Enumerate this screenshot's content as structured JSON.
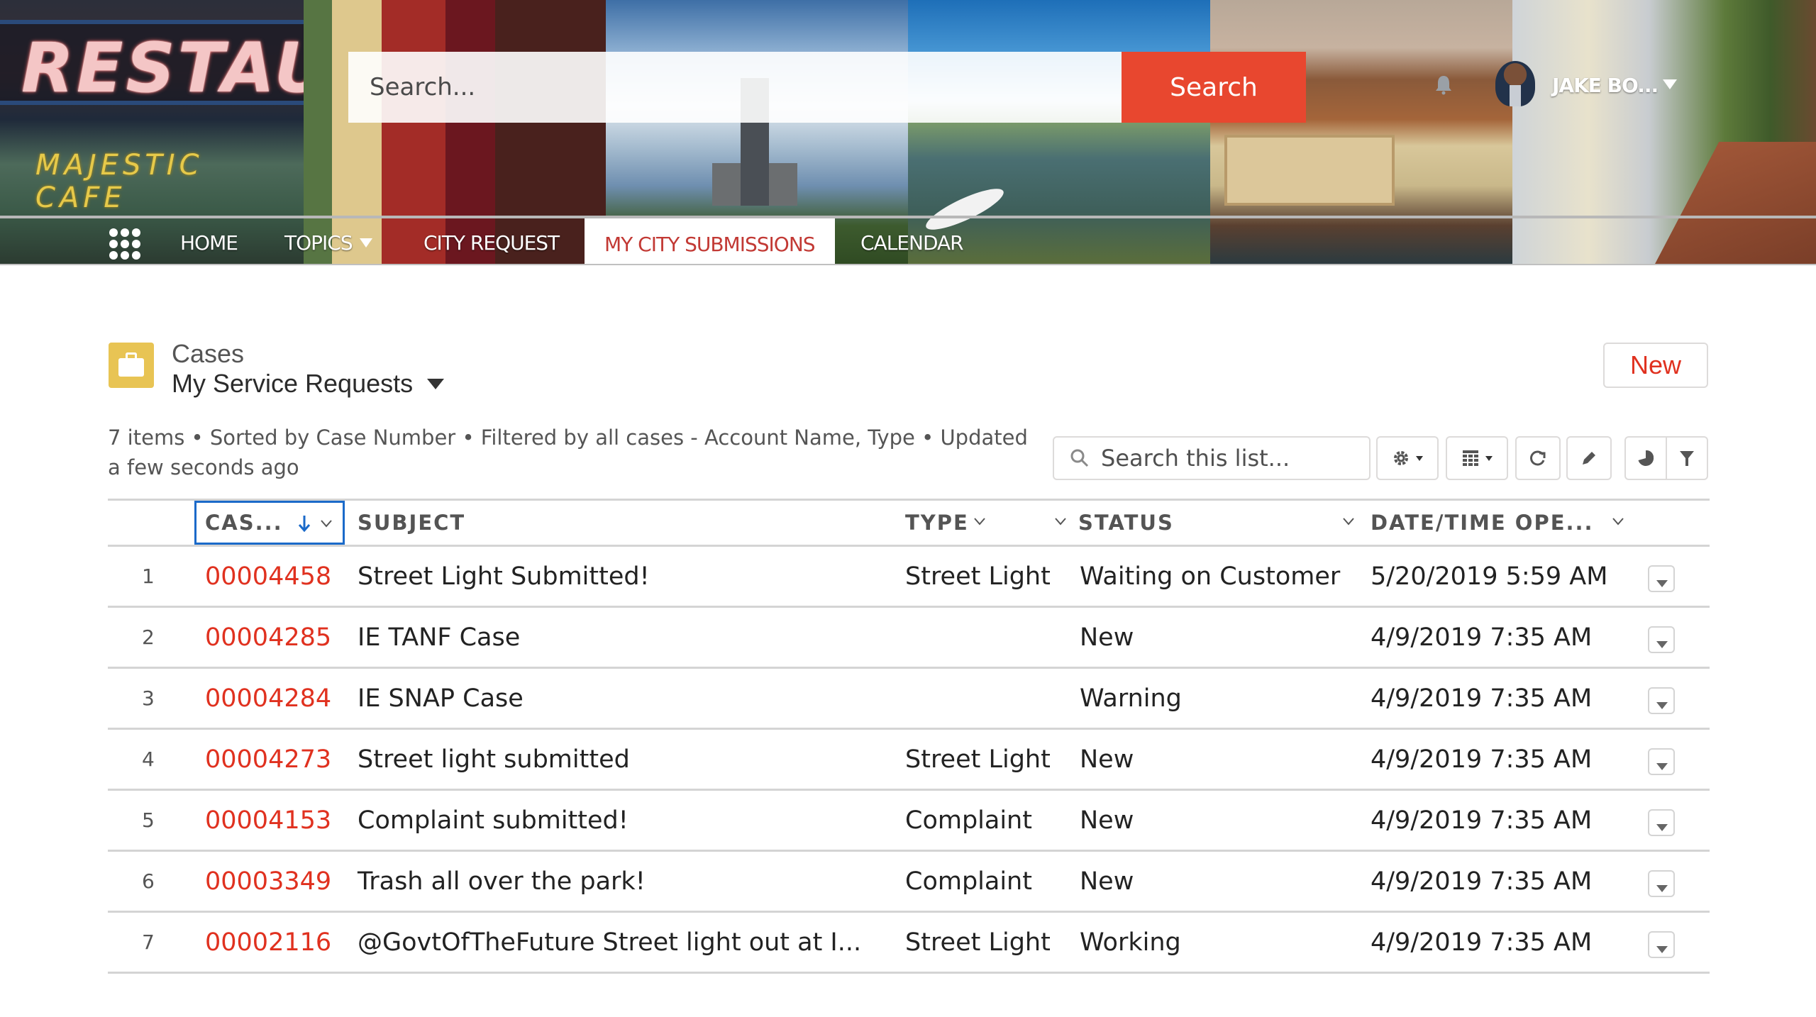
{
  "header": {
    "search": {
      "placeholder": "Search...",
      "button_label": "Search"
    },
    "user": {
      "name": "JAKE BO..."
    },
    "banner_text": {
      "restaurant_sign": "RESTAU",
      "cafe_sign": "MAJESTIC CAFE"
    }
  },
  "nav": {
    "items": [
      {
        "label": "HOME"
      },
      {
        "label": "TOPICS",
        "has_dropdown": true
      },
      {
        "label": "CITY REQUEST"
      },
      {
        "label": "MY CITY SUBMISSIONS",
        "active": true
      },
      {
        "label": "CALENDAR"
      }
    ]
  },
  "list_view": {
    "object_label": "Cases",
    "view_name": "My Service Requests",
    "new_button": "New",
    "meta_line1": "7 items • Sorted by Case Number • Filtered by all cases - Account Name, Type • Updated",
    "meta_line2": "a few seconds ago",
    "search_placeholder": "Search this list...",
    "colors": {
      "accent": "#e0311f",
      "sort_border": "#1b6ac9",
      "icon_bg": "#e8c454",
      "search_btn": "#e8472f"
    },
    "columns": [
      {
        "label": "CAS...",
        "sorted": "desc"
      },
      {
        "label": "SUBJECT"
      },
      {
        "label": "TYPE"
      },
      {
        "label": "STATUS"
      },
      {
        "label": "DATE/TIME OPE..."
      }
    ],
    "rows": [
      {
        "n": "1",
        "case": "00004458",
        "subject": "Street Light Submitted!",
        "type": "Street Light",
        "status": "Waiting on Customer",
        "opened": "5/20/2019 5:59 AM"
      },
      {
        "n": "2",
        "case": "00004285",
        "subject": "IE TANF Case",
        "type": "",
        "status": "New",
        "opened": "4/9/2019 7:35 AM"
      },
      {
        "n": "3",
        "case": "00004284",
        "subject": "IE SNAP Case",
        "type": "",
        "status": "Warning",
        "opened": "4/9/2019 7:35 AM"
      },
      {
        "n": "4",
        "case": "00004273",
        "subject": "Street light submitted",
        "type": "Street Light",
        "status": "New",
        "opened": "4/9/2019 7:35 AM"
      },
      {
        "n": "5",
        "case": "00004153",
        "subject": "Complaint submitted!",
        "type": "Complaint",
        "status": "New",
        "opened": "4/9/2019 7:35 AM"
      },
      {
        "n": "6",
        "case": "00003349",
        "subject": "Trash all over the park!",
        "type": "Complaint",
        "status": "New",
        "opened": "4/9/2019 7:35 AM"
      },
      {
        "n": "7",
        "case": "00002116",
        "subject": "@GovtOfTheFuture Street light out at I...",
        "type": "Street Light",
        "status": "Working",
        "opened": "4/9/2019 7:35 AM"
      }
    ]
  }
}
